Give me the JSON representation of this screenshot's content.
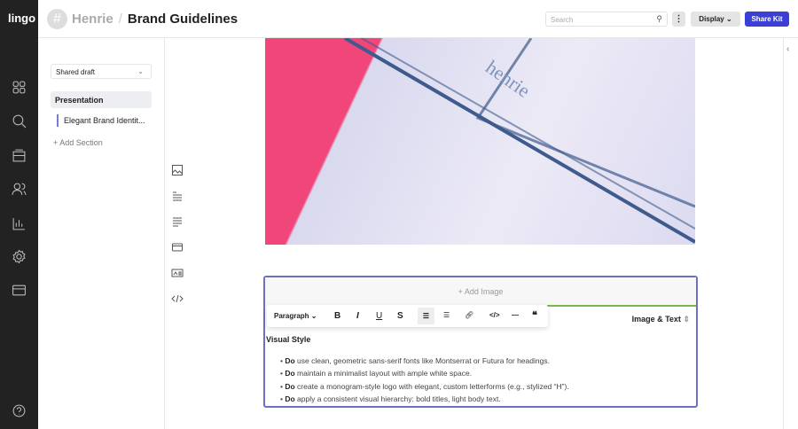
{
  "app": {
    "logo": "lingo"
  },
  "header": {
    "org": "Henrie",
    "separator": "/",
    "title": "Brand Guidelines",
    "search_placeholder": "Search",
    "display_label": "Display",
    "share_label": "Share Kit",
    "more": "⋮"
  },
  "left": {
    "draft": "Shared draft",
    "presentation": "Presentation",
    "section": "Elegant Brand Identit...",
    "add_section": "Add Section"
  },
  "editor": {
    "add_image": "Add Image",
    "style": "Paragraph",
    "layout": "Image & Text",
    "heading": "Visual Style",
    "bullets": [
      {
        "b": "Do",
        "t": " use clean, geometric sans-serif fonts like Montserrat or Futura for headings."
      },
      {
        "b": "Do",
        "t": " maintain a minimalist layout with ample white space."
      },
      {
        "b": "Do",
        "t": " create a monogram-style logo with elegant, custom letterforms (e.g., stylized “H”)."
      },
      {
        "b": "Do",
        "t": " apply a consistent visual hierarchy: bold titles, light body text."
      }
    ]
  },
  "image": {
    "text": "henrie"
  },
  "colors": {
    "accent": "#3b3fd6",
    "rail": "#222222",
    "pink": "#f0467a",
    "green": "#76b84a"
  }
}
